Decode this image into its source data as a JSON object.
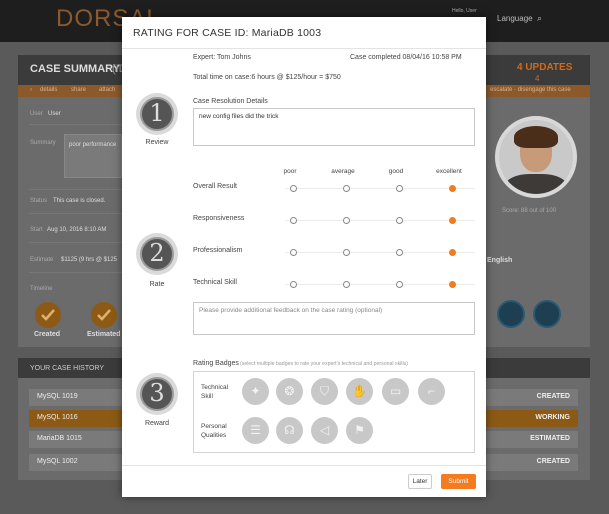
{
  "background": {
    "logo": "DORSAL",
    "hello": "Hello, User",
    "language": "Language",
    "case_summary_title": "CASE SUMMARY",
    "case_summary_id": "(ID",
    "updates": "4 UPDATES",
    "updates_count": "4",
    "strip_links": [
      "details",
      "share",
      "attach"
    ],
    "strip_right": "escalate · disengage this case",
    "fields": [
      {
        "label": "User",
        "value": "User"
      },
      {
        "label": "Summary",
        "value": "poor performance"
      },
      {
        "label": "Status",
        "value": "This case is closed."
      },
      {
        "label": "Start",
        "value": "Aug 10, 2016 8:10 AM"
      },
      {
        "label": "Estimate",
        "value": "$1125 (9 hrs @ $125"
      },
      {
        "label": "Timeline",
        "value": ""
      }
    ],
    "score": "Score: 88 out of 100",
    "language_value": "English",
    "timeline": [
      {
        "label": "Created"
      },
      {
        "label": "Estimated"
      }
    ],
    "history_title": "YOUR CASE HISTORY",
    "history": [
      {
        "name": "MySQL 1019",
        "status": "CREATED",
        "active": false
      },
      {
        "name": "MySQL 1016",
        "status": "WORKING",
        "active": true
      },
      {
        "name": "MariaDB 1015",
        "status": "ESTIMATED",
        "active": false
      },
      {
        "name": "MySQL 1002",
        "status": "CREATED",
        "active": false
      }
    ]
  },
  "modal": {
    "title": "RATING FOR CASE ID: MariaDB 1003",
    "expert": "Expert: Tom Johns",
    "completed": "Case completed 08/04/16 10:58 PM",
    "total_time": "Total time on case:6 hours @ $125/hour = $750",
    "steps": [
      {
        "number": "1",
        "label": "Review"
      },
      {
        "number": "2",
        "label": "Rate"
      },
      {
        "number": "3",
        "label": "Reward"
      }
    ],
    "resolution_label": "Case Resolution Details",
    "resolution_text": "new config files did the trick",
    "scale": [
      "poor",
      "average",
      "good",
      "excellent"
    ],
    "criteria": [
      {
        "label": "Overall Result",
        "rating": 4
      },
      {
        "label": "Responsiveness",
        "rating": 4
      },
      {
        "label": "Professionalism",
        "rating": 4
      },
      {
        "label": "Technical Skill",
        "rating": 4
      }
    ],
    "feedback_placeholder": "Please provide additional feedback on the case rating (optional)",
    "badges_label": "Rating Badges",
    "badges_hint": "(select multiple badges to rate your expert's technical and personal skills)",
    "technical_label": "Technical Skill",
    "personal_label": "Personal Qualities",
    "technical_badges": [
      "wizard-icon",
      "brain-icon",
      "shield-icon",
      "thumbs-up-icon",
      "devices-icon",
      "stairs-icon"
    ],
    "personal_badges": [
      "checklist-icon",
      "speaking-head-icon",
      "megaphone-icon",
      "checkered-flag-icon"
    ],
    "later_label": "Later",
    "submit_label": "Submit"
  }
}
